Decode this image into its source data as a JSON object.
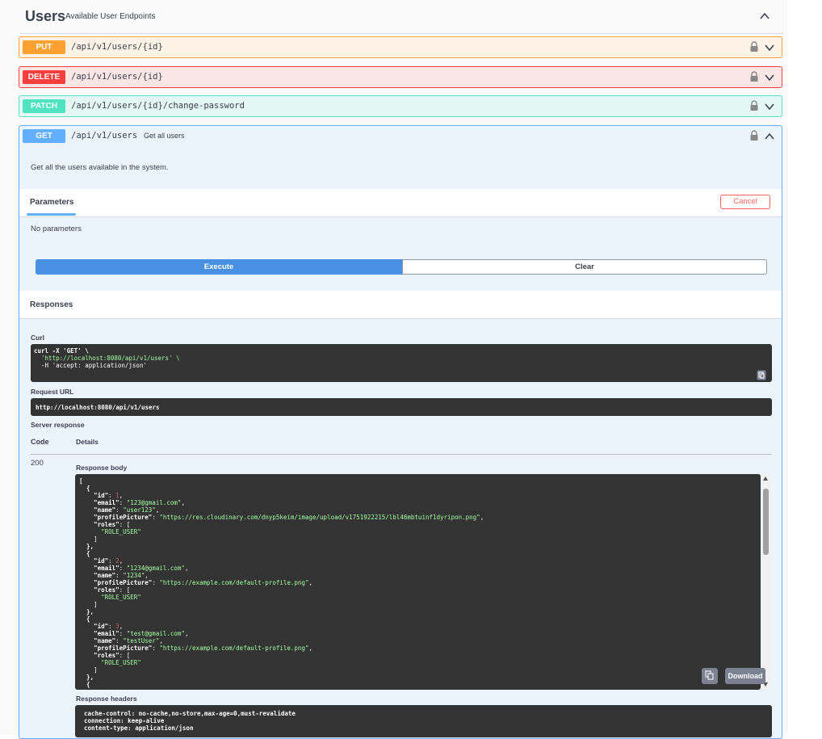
{
  "tag": {
    "title": "Users",
    "description": "Available User Endpoints",
    "chevron_icon": "chevron-up-icon"
  },
  "operations": [
    {
      "method": "PUT",
      "path": "/api/v1/users/{id}",
      "summary": "",
      "color": "#fca130"
    },
    {
      "method": "DELETE",
      "path": "/api/v1/users/{id}",
      "summary": "",
      "color": "#f93e3e"
    },
    {
      "method": "PATCH",
      "path": "/api/v1/users/{id}/change-password",
      "summary": "",
      "color": "#50e3c2"
    },
    {
      "method": "GET",
      "path": "/api/v1/users",
      "summary": "Get all users",
      "color": "#61affe"
    }
  ],
  "get_panel": {
    "description": "Get all the users available in the system.",
    "parameters_tab": "Parameters",
    "cancel_label": "Cancel",
    "no_params": "No parameters",
    "execute_label": "Execute",
    "clear_label": "Clear",
    "responses_title": "Responses",
    "curl_label": "Curl",
    "curl_lines": [
      "curl -X 'GET' \\",
      "  'http://localhost:8080/api/v1/users' \\",
      "  -H 'accept: application/json'"
    ],
    "request_url_label": "Request URL",
    "request_url": "http://localhost:8080/api/v1/users",
    "server_response_label": "Server response",
    "code_header": "Code",
    "details_header": "Details",
    "status_code": "200",
    "response_body_label": "Response body",
    "download_label": "Download",
    "response_headers_label": "Response headers",
    "users": [
      {
        "id": 1,
        "email": "123@gmail.com",
        "name": "user123",
        "profilePicture": "https://res.cloudinary.com/dnyp5keim/image/upload/v1751922215/lbl46mbtuinf1dyripon.png",
        "roles": [
          "ROLE_USER"
        ]
      },
      {
        "id": 2,
        "email": "1234@gmail.com",
        "name": "1234",
        "profilePicture": "https://example.com/default-profile.png",
        "roles": [
          "ROLE_USER"
        ]
      },
      {
        "id": 3,
        "email": "test@gmail.com",
        "name": "testUser",
        "profilePicture": "https://example.com/default-profile.png",
        "roles": [
          "ROLE_USER"
        ]
      }
    ],
    "response_headers": [
      "cache-control: no-cache,no-store,max-age=0,must-revalidate",
      "connection: keep-alive",
      "content-type: application/json"
    ]
  },
  "colors": {
    "get": "#61affe",
    "put": "#fca130",
    "delete": "#f93e3e",
    "patch": "#50e3c2",
    "execute": "#4990e2",
    "cancel": "#ff6060"
  },
  "icons": {
    "lock": "lock-icon",
    "chevron_down": "chevron-down-icon",
    "chevron_up": "chevron-up-icon",
    "copy": "copy-to-clipboard-icon"
  }
}
